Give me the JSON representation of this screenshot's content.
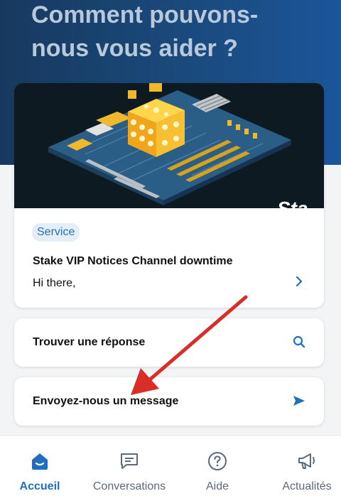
{
  "hero": {
    "title": "Comment pouvons-nous vous aider ?"
  },
  "article": {
    "tag": "Service",
    "title": "Stake VIP Notices Channel downtime",
    "excerpt": "Hi there,",
    "banner_text": "Sta"
  },
  "actions": {
    "find_label": "Trouver une réponse",
    "send_label": "Envoyez-nous un message"
  },
  "nav": {
    "items": [
      {
        "label": "Accueil"
      },
      {
        "label": "Conversations"
      },
      {
        "label": "Aide"
      },
      {
        "label": "Actualités"
      }
    ]
  },
  "colors": {
    "accent": "#1f6fc0",
    "hero_bg": "#1a4a7c",
    "annotation_arrow": "#d92d27"
  }
}
